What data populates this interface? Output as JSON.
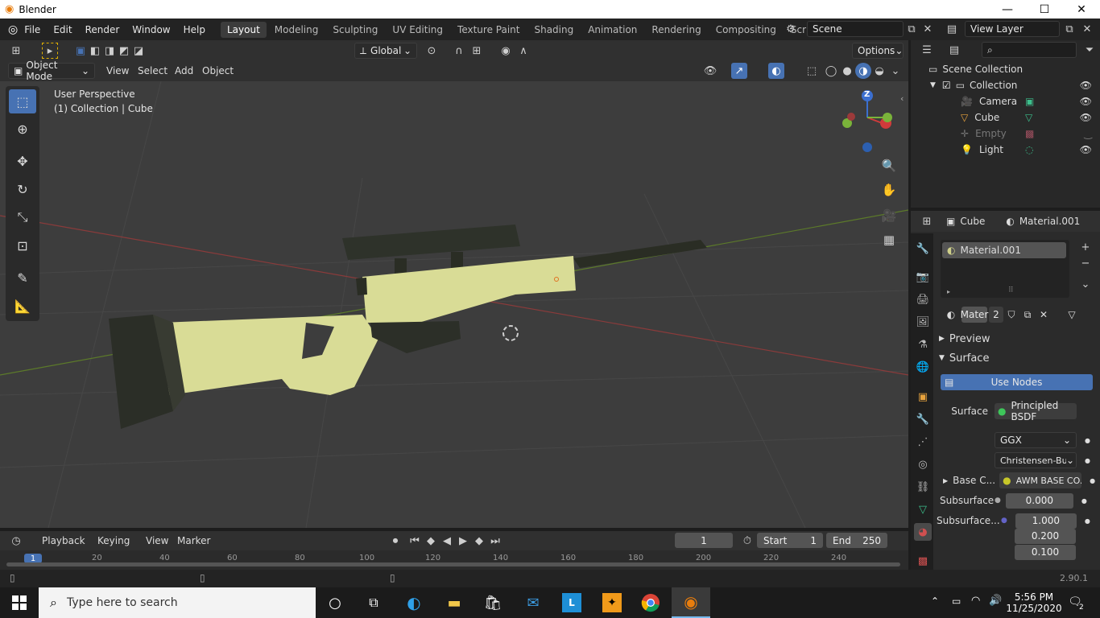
{
  "window": {
    "app_name": "Blender",
    "minimize": "—",
    "maximize": "☐",
    "close": "✕"
  },
  "menu": [
    "File",
    "Edit",
    "Render",
    "Window",
    "Help"
  ],
  "workspaces": [
    "Layout",
    "Modeling",
    "Sculpting",
    "UV Editing",
    "Texture Paint",
    "Shading",
    "Animation",
    "Rendering",
    "Compositing",
    "Scripting"
  ],
  "active_workspace": "Layout",
  "scene_name": "Scene",
  "view_layer": "View Layer",
  "toolheader": {
    "orientation": "Global",
    "options": "Options"
  },
  "viewport_header": {
    "mode": "Object Mode",
    "menus": [
      "View",
      "Select",
      "Add",
      "Object"
    ]
  },
  "viewport": {
    "perspective": "User Perspective",
    "collection_info": "(1) Collection | Cube"
  },
  "gizmo": {
    "z": "Z"
  },
  "outliner": {
    "root": "Scene Collection",
    "collection": "Collection",
    "items": [
      {
        "name": "Camera",
        "disabled": false
      },
      {
        "name": "Cube",
        "disabled": false
      },
      {
        "name": "Empty",
        "disabled": true
      },
      {
        "name": "Light",
        "disabled": false
      }
    ]
  },
  "properties": {
    "object": "Cube",
    "material": "Material.001",
    "slot": "Material.001",
    "mat_field": "Mater",
    "users": "2",
    "preview": "Preview",
    "surface": "Surface",
    "use_nodes": "Use Nodes",
    "rows": [
      {
        "label": "Surface",
        "value": "Principled BSDF"
      },
      {
        "label": "",
        "value": "GGX"
      },
      {
        "label": "",
        "value": "Christensen-Bur..."
      },
      {
        "label": "Base C...",
        "value": "AWM BASE CO..."
      },
      {
        "label": "Subsurface",
        "value": "0.000"
      },
      {
        "label": "Subsurface...",
        "value": "1.000"
      },
      {
        "label": "",
        "value": "0.200"
      },
      {
        "label": "",
        "value": "0.100"
      }
    ]
  },
  "timeline": {
    "menus": [
      "Playback",
      "Keying",
      "View",
      "Marker"
    ],
    "current_frame": "1",
    "start_label": "Start",
    "start": "1",
    "end_label": "End",
    "end": "250",
    "ticks": [
      "1",
      "20",
      "40",
      "60",
      "80",
      "100",
      "120",
      "140",
      "160",
      "180",
      "200",
      "220",
      "240"
    ]
  },
  "status": {
    "version": "2.90.1"
  },
  "taskbar": {
    "search_placeholder": "Type here to search",
    "time": "5:56 PM",
    "date": "11/25/2020",
    "notifications": "2"
  },
  "colors": {
    "accent": "#4772b3",
    "rifle_body": "#d9dc96",
    "viewport_bg": "#3d3d3d"
  }
}
